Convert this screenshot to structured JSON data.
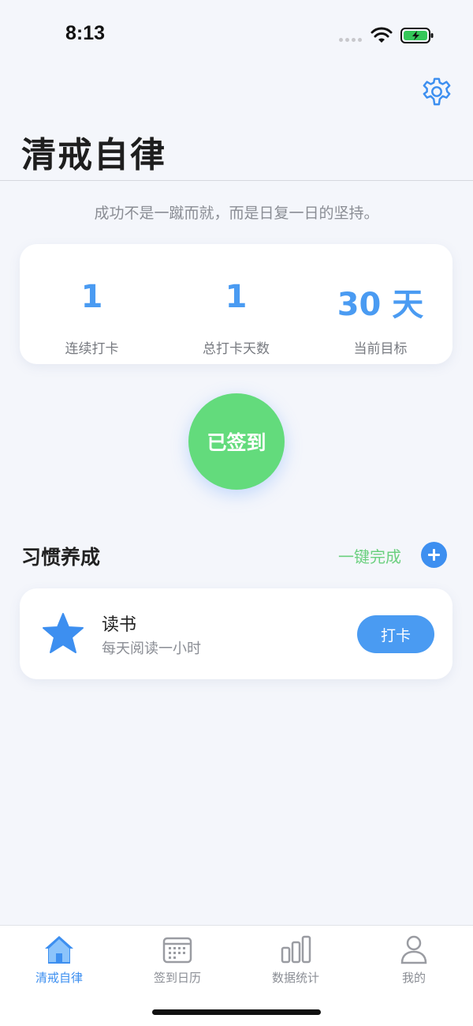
{
  "status_bar": {
    "time": "8:13",
    "icons": [
      "signal-dots-icon",
      "wifi-icon",
      "battery-charging-icon"
    ],
    "battery_color": "#34c759"
  },
  "header": {
    "settings_icon": "gear-icon",
    "title": "清戒自律",
    "motto": "成功不是一蹴而就，而是日复一日的坚持。"
  },
  "stats": [
    {
      "value": "1",
      "label": "连续打卡"
    },
    {
      "value": "1",
      "label": "总打卡天数"
    },
    {
      "value": "30 天",
      "label": "当前目标"
    }
  ],
  "checkin": {
    "label": "已签到",
    "color": "#63db7c"
  },
  "habits_section": {
    "title": "习惯养成",
    "complete_all_label": "一键完成",
    "add_icon": "plus-icon",
    "items": [
      {
        "icon": "star-icon",
        "name": "读书",
        "description": "每天阅读一小时",
        "action_label": "打卡"
      }
    ]
  },
  "tab_bar": {
    "tabs": [
      {
        "label": "清戒自律",
        "icon": "home-icon",
        "active": true
      },
      {
        "label": "签到日历",
        "icon": "calendar-icon",
        "active": false
      },
      {
        "label": "数据统计",
        "icon": "bar-chart-icon",
        "active": false
      },
      {
        "label": "我的",
        "icon": "person-icon",
        "active": false
      }
    ]
  },
  "colors": {
    "accent": "#4a9bf2",
    "success": "#63db7c",
    "background": "#f4f6fb"
  }
}
